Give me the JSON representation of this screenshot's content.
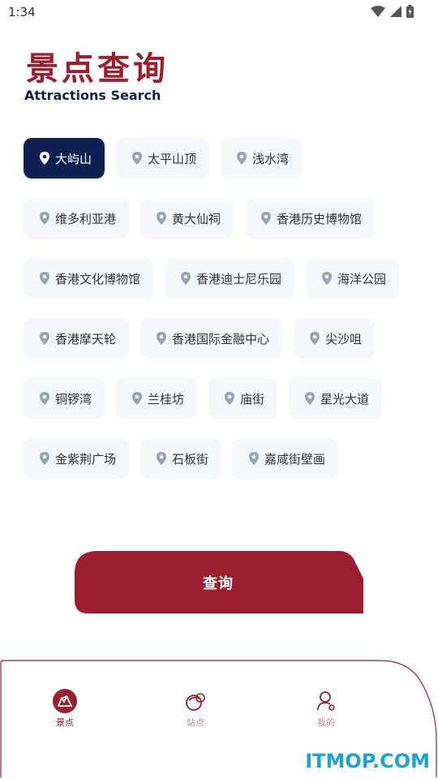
{
  "status_bar": {
    "time": "1:34"
  },
  "header": {
    "title": "景点查询",
    "subtitle": "Attractions Search"
  },
  "attractions": {
    "rows": [
      [
        {
          "label": "大屿山",
          "selected": true
        },
        {
          "label": "太平山顶"
        },
        {
          "label": "浅水湾"
        }
      ],
      [
        {
          "label": "维多利亚港"
        },
        {
          "label": "黄大仙祠"
        },
        {
          "label": "香港历史博物馆"
        }
      ],
      [
        {
          "label": "香港文化博物馆"
        },
        {
          "label": "香港迪士尼乐园"
        },
        {
          "label": "海洋公园"
        }
      ],
      [
        {
          "label": "香港摩天轮"
        },
        {
          "label": "香港国际金融中心"
        },
        {
          "label": "尖沙咀"
        }
      ],
      [
        {
          "label": "铜锣湾"
        },
        {
          "label": "兰桂坊"
        },
        {
          "label": "庙街"
        },
        {
          "label": "星光大道"
        }
      ],
      [
        {
          "label": "金紫荆广场"
        },
        {
          "label": "石板街"
        },
        {
          "label": "嘉咸街壁画"
        }
      ]
    ]
  },
  "query_button": {
    "label": "查询"
  },
  "bottom_nav": {
    "items": [
      {
        "label": "景点",
        "icon": "attractions-icon",
        "active": true
      },
      {
        "label": "站点",
        "icon": "station-icon"
      },
      {
        "label": "我的",
        "icon": "profile-icon"
      }
    ]
  },
  "watermark": "ITMOP.COM",
  "colors": {
    "accent": "#9b1f2f",
    "navy": "#0f2150",
    "chip_bg": "#f4f7fb"
  }
}
